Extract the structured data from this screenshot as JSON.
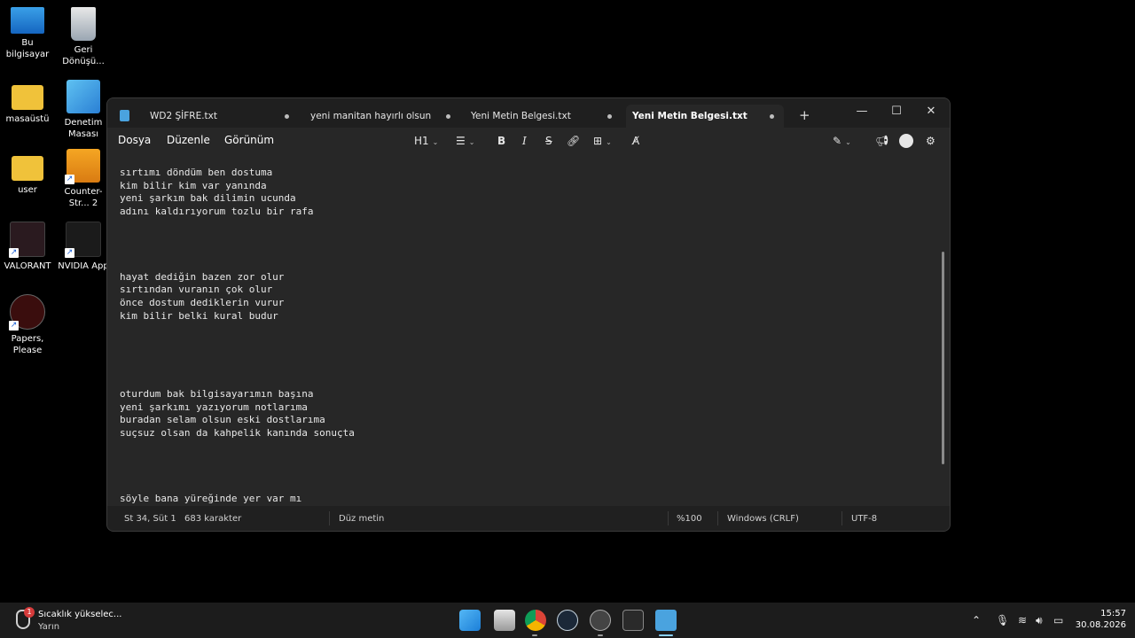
{
  "desktop": {
    "icons": [
      {
        "label": "Bu bilgisayar"
      },
      {
        "label": "Geri Dönüşü..."
      },
      {
        "label": "masaüstü"
      },
      {
        "label": "Denetim Masası"
      },
      {
        "label": "user"
      },
      {
        "label": "Counter-Str... 2"
      },
      {
        "label": "VALORANT"
      },
      {
        "label": "NVIDIA App"
      },
      {
        "label": "Papers, Please"
      }
    ]
  },
  "notepad": {
    "tabs": [
      {
        "label": "WD2 ŞİFRE.txt",
        "unsaved": true,
        "active": false
      },
      {
        "label": "yeni manitan hayırlı olsun",
        "unsaved": true,
        "active": false
      },
      {
        "label": "Yeni Metin Belgesi.txt",
        "unsaved": true,
        "active": false
      },
      {
        "label": "Yeni Metin Belgesi.txt",
        "unsaved": true,
        "active": true
      }
    ],
    "new_tab": "+",
    "window_controls": {
      "minimize": "—",
      "maximize": "☐",
      "close": "✕"
    },
    "menu": {
      "file": "Dosya",
      "edit": "Düzenle",
      "view": "Görünüm"
    },
    "toolbar": {
      "heading": "H1",
      "list_icon": "list-icon",
      "bold": "B",
      "italic": "I",
      "strike": "S",
      "link_icon": "link-icon",
      "table_icon": "table-icon",
      "clear_format_icon": "clear-formatting-icon",
      "copilot_icon": "copilot-icon",
      "announce_icon": "megaphone-icon",
      "account_icon": "account-icon",
      "settings_icon": "gear-icon"
    },
    "content": [
      "sırtımı döndüm ben dostuma",
      "kim bilir kim var yanında",
      "yeni şarkım bak dilimin ucunda",
      "adını kaldırıyorum tozlu bir rafa",
      "",
      "",
      "",
      "",
      "hayat dediğin bazen zor olur",
      "sırtından vuranın çok olur",
      "önce dostum dediklerin vurur",
      "kim bilir belki kural budur",
      "",
      "",
      "",
      "",
      "",
      "oturdum bak bilgisayarımın başına",
      "yeni şarkımı yazıyorum notlarıma",
      "buradan selam olsun eski dostlarıma",
      "suçsuz olsan da kahpelik kanında sonuçta",
      "",
      "",
      "",
      "",
      "söyle bana yüreğinde yer var mı"
    ],
    "status": {
      "position": "St 34, Süt 1",
      "char_count": "683 karakter",
      "format": "Düz metin",
      "zoom": "%100",
      "line_ending": "Windows (CRLF)",
      "encoding": "UTF-8"
    }
  },
  "taskbar": {
    "weather_title": "Sıcaklık yükselec...",
    "weather_sub": "Yarın",
    "notification_count": "1",
    "apps": [
      "start-icon",
      "file-explorer-icon",
      "chrome-icon",
      "steam-icon",
      "discord-icon",
      "epic-games-icon",
      "notepad-icon"
    ],
    "time": "15:57",
    "date": "30.08.2026"
  },
  "colors": {
    "desktop_bg": "#000000",
    "window_bg": "#272727",
    "tab_bar": "#1f1f1f",
    "taskbar": "#1c1c1c",
    "accent": "#4aa3df"
  }
}
